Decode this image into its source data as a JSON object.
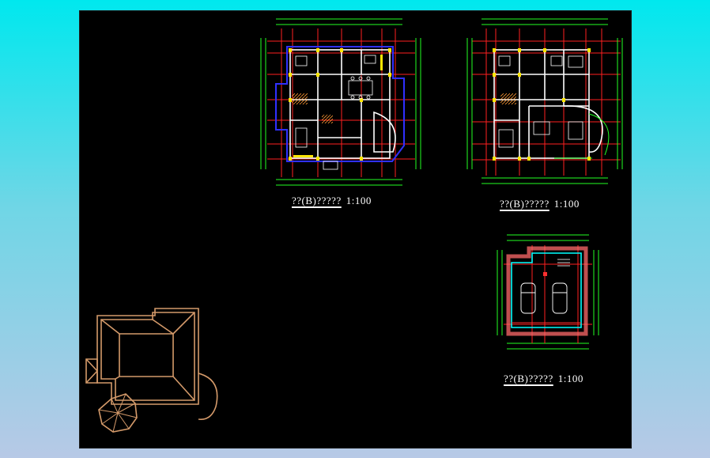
{
  "drawings": {
    "plan_first": {
      "title": "??(B)?????",
      "scale": "1:100"
    },
    "plan_second": {
      "title": "??(B)?????",
      "scale": "1:100"
    },
    "plan_garage": {
      "title": "??(B)?????",
      "scale": "1:100"
    }
  },
  "colors": {
    "background_sheet": "#000000",
    "axis_red": "#ff2020",
    "dimension_green": "#22ff22",
    "wall_white": "#ffffff",
    "column_yellow": "#ffe600",
    "outline_blue": "#3030ff",
    "garage_cyan": "#00ffff",
    "roof_tan": "#d49a6a"
  }
}
